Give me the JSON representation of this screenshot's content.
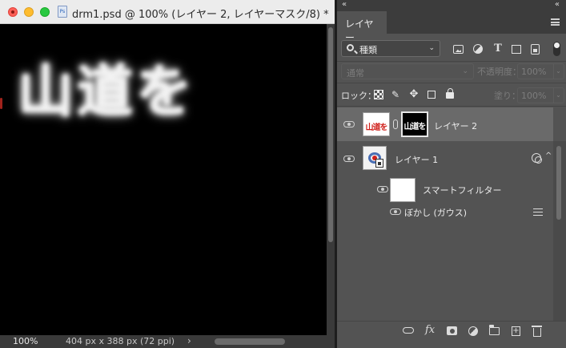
{
  "document": {
    "title": "drm1.psd @ 100% (レイヤー 2, レイヤーマスク/8) *",
    "file_icon": "Ps",
    "canvas_text": "山道を",
    "status": {
      "zoom": "100%",
      "dimensions": "404 px x 388 px (72 ppi)",
      "arrow": "›"
    }
  },
  "panel": {
    "collapse_left": "«",
    "collapse_right": "«",
    "tab_label": "レイヤー",
    "filter": {
      "kind_label": "種類",
      "icons": [
        "pixel-filter-icon",
        "adjustment-filter-icon",
        "type-filter-icon",
        "shape-filter-icon",
        "smart-object-filter-icon"
      ],
      "type_icon_glyph": "T"
    },
    "blend": {
      "mode": "通常",
      "opacity_label": "不透明度：",
      "opacity_value": "100%"
    },
    "lock": {
      "label": "ロック：",
      "fill_label": "塗り：",
      "fill_value": "100%",
      "brush_glyph": "✎",
      "move_glyph": "✥"
    },
    "layers": [
      {
        "name": "レイヤー 2",
        "thumb_text": "山道を",
        "mask_text": "山道を",
        "selected": true
      },
      {
        "name": "レイヤー 1"
      },
      {
        "name": "スマートフィルター"
      },
      {
        "name": "ぼかし (ガウス)"
      }
    ],
    "bottom": {
      "fx_label": "fx",
      "new_glyph": "+"
    },
    "chevron": "⌄",
    "caret": "^"
  },
  "colors": {
    "panel_bg": "#535353",
    "selected_row": "#6a6a6a",
    "canvas": "#000000",
    "thumb_red": "#d0201b"
  }
}
